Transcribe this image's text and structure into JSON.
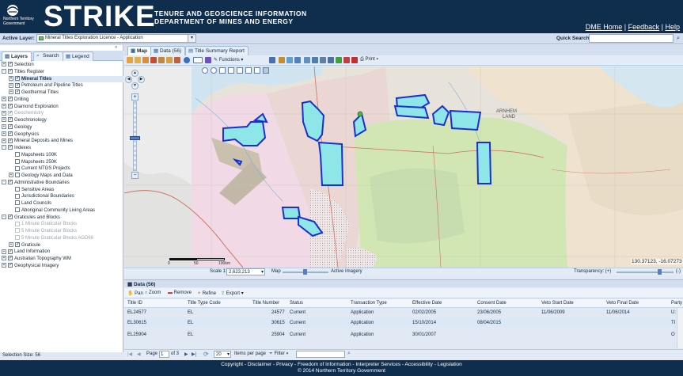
{
  "header": {
    "logo_text": "Northern Territory Government",
    "title": "STRIKE",
    "subtitle_line1": "TENURE AND GEOSCIENCE INFORMATION",
    "subtitle_line2": "DEPARTMENT OF MINES AND ENERGY",
    "links": [
      "DME Home",
      "Feedback",
      "Help"
    ]
  },
  "active_layer": {
    "label": "Active Layer:",
    "value": "Mineral Titles Exploration Licence - Application"
  },
  "quick_search": {
    "label": "Quick Search:",
    "value": ""
  },
  "left_tabs": [
    "Layers",
    "Search",
    "Legend"
  ],
  "layer_tree": [
    {
      "label": "Selection",
      "level": 0,
      "checked": true,
      "expand": "+"
    },
    {
      "label": "Titles Register",
      "level": 0,
      "checked": true,
      "expand": "-"
    },
    {
      "label": "Mineral Titles",
      "level": 1,
      "checked": true,
      "expand": "+",
      "bold": true,
      "selected": true
    },
    {
      "label": "Petroleum and Pipeline Titles",
      "level": 1,
      "checked": true,
      "expand": "+"
    },
    {
      "label": "Geothermal Titles",
      "level": 1,
      "checked": true,
      "expand": "+"
    },
    {
      "label": "Drilling",
      "level": 0,
      "checked": true,
      "expand": "+"
    },
    {
      "label": "Diamond Exploration",
      "level": 0,
      "checked": true,
      "expand": "+"
    },
    {
      "label": "Geochemistry",
      "level": 0,
      "checked": true,
      "expand": "+",
      "dim": true
    },
    {
      "label": "Geochronology",
      "level": 0,
      "checked": true,
      "expand": "+"
    },
    {
      "label": "Geology",
      "level": 0,
      "checked": true,
      "expand": "+"
    },
    {
      "label": "Geophysics",
      "level": 0,
      "checked": true,
      "expand": "+"
    },
    {
      "label": "Mineral Deposits and Mines",
      "level": 0,
      "checked": true,
      "expand": "+"
    },
    {
      "label": "Indexes",
      "level": 0,
      "checked": true,
      "expand": "-"
    },
    {
      "label": "Mapsheets 100K",
      "level": 1,
      "checked": false
    },
    {
      "label": "Mapsheets 250K",
      "level": 1,
      "checked": false
    },
    {
      "label": "Current NTGS Projects",
      "level": 1,
      "checked": false
    },
    {
      "label": "Geology Maps and Data",
      "level": 1,
      "checked": false,
      "expand": "+"
    },
    {
      "label": "Administrative Boundaries",
      "level": 0,
      "checked": true,
      "expand": "-"
    },
    {
      "label": "Sensitive Areas",
      "level": 1,
      "checked": false
    },
    {
      "label": "Jurisdictional Boundaries",
      "level": 1,
      "checked": false
    },
    {
      "label": "Land Councils",
      "level": 1,
      "checked": false
    },
    {
      "label": "Aboriginal Community Living Areas",
      "level": 1,
      "checked": false
    },
    {
      "label": "Graticules and Blocks",
      "level": 0,
      "checked": true,
      "expand": "-"
    },
    {
      "label": "1 Minute Graticular Blocks",
      "level": 1,
      "checked": false,
      "dim": true
    },
    {
      "label": "5 Minute Graticular Blocks",
      "level": 1,
      "checked": false,
      "dim": true
    },
    {
      "label": "5 Minute Graticular Blocks AGD66",
      "level": 1,
      "checked": false,
      "dim": true
    },
    {
      "label": "Graticule",
      "level": 1,
      "checked": true,
      "expand": "+"
    },
    {
      "label": "Land Information",
      "level": 0,
      "checked": true,
      "expand": "+"
    },
    {
      "label": "Australian Topography WM",
      "level": 0,
      "checked": true,
      "expand": "+"
    },
    {
      "label": "Geophysical Imagery",
      "level": 0,
      "checked": true,
      "expand": "+"
    }
  ],
  "selection_size": "Selection Size: 56",
  "main_tabs": [
    "Map",
    "Data (56)",
    "Title Summary Report"
  ],
  "map_toolbar": {
    "functions_label": "Functions",
    "print_label": "Print"
  },
  "map_labels": [
    "ARNHEM",
    "LAND"
  ],
  "map_status": {
    "scale_ticks": [
      "0",
      "50",
      "100km"
    ],
    "scale_label": "Scale 1:",
    "scale_value": "2,623,213",
    "map_label": "Map",
    "imagery_label": "Active Imagery",
    "transparency_label": "Transparency: (+)",
    "transparency_minus": "(-)",
    "coords": "130.37123, -16.07273"
  },
  "data_panel": {
    "title": "Data (56)",
    "toolbar": [
      "Pan",
      "Zoom",
      "Remove",
      "Refine",
      "Export"
    ],
    "columns": [
      "Title ID",
      "Title Type Code",
      "Title Number",
      "Status",
      "Transaction Type",
      "Effective Date",
      "Consent Date",
      "Veto Start Date",
      "Veto Final Date",
      "Party"
    ],
    "rows": [
      {
        "id": "EL24577",
        "type": "EL",
        "number": "24577",
        "status": "Current",
        "transaction": "Application",
        "effective": "02/02/2005",
        "consent": "23/06/2005",
        "veto_start": "11/06/2009",
        "veto_final": "11/06/2014",
        "party": "U:"
      },
      {
        "id": "EL30615",
        "type": "EL",
        "number": "30615",
        "status": "Current",
        "transaction": "Application",
        "effective": "15/10/2014",
        "consent": "08/04/2015",
        "veto_start": "",
        "veto_final": "",
        "party": "TI"
      },
      {
        "id": "EL25904",
        "type": "EL",
        "number": "25904",
        "status": "Current",
        "transaction": "Application",
        "effective": "30/01/2007",
        "consent": "",
        "veto_start": "",
        "veto_final": "",
        "party": "O"
      }
    ]
  },
  "pager": {
    "page_label": "Page",
    "page_value": "1",
    "of_label": "of 3",
    "per_page_value": "20",
    "per_page_label": "Items per page",
    "filter_label": "Filter"
  },
  "footer": {
    "links": [
      "Copyright",
      "Disclaimer",
      "Privacy",
      "Freedom of Information",
      "Interpreter Services",
      "Accessibility",
      "Legislation"
    ],
    "copyright": "© 2014 Northern Territory Government"
  }
}
